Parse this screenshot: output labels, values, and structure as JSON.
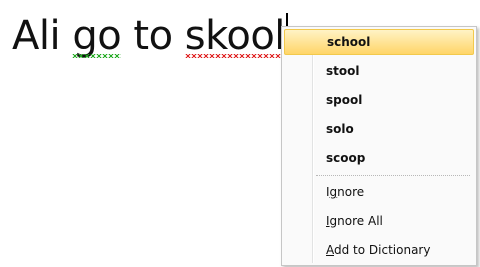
{
  "document": {
    "words": [
      "Ali",
      "go",
      "to",
      "skool"
    ]
  },
  "context_menu": {
    "suggestions": [
      "school",
      "stool",
      "spool",
      "solo",
      "scoop"
    ],
    "ignore": {
      "accel": "g",
      "pre": "I",
      "post": "nore"
    },
    "ignore_all": {
      "accel": "I",
      "pre": "",
      "post": "gnore All"
    },
    "add_to_dictionary": {
      "accel": "A",
      "pre": "",
      "post": "dd to Dictionary"
    }
  },
  "colors": {
    "grammar_underline": "#22aa22",
    "spelling_underline": "#e02020",
    "highlight": "#ffd568"
  }
}
